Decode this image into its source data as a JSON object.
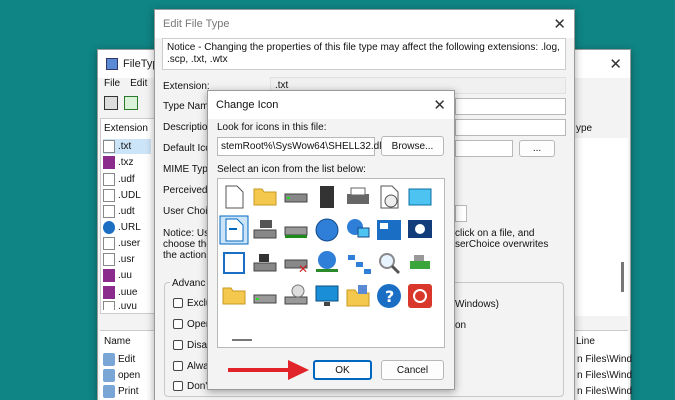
{
  "filetypes_window": {
    "title": "FileTyp",
    "menu": [
      "File",
      "Edit"
    ],
    "column_header": "Extension",
    "right_header": "ype",
    "extensions": [
      ".txt",
      ".txz",
      ".udf",
      ".UDL",
      ".udt",
      ".URL",
      ".user",
      ".usr",
      ".uu",
      ".uue",
      ".uvu"
    ],
    "bottom_header": "Name",
    "bottom_right_header": "Line",
    "actions": [
      "Edit",
      "open",
      "Print"
    ],
    "right_paths": [
      "n Files\\Wind",
      "n Files\\Wind",
      "n Files\\Wind"
    ]
  },
  "edit_window": {
    "title": "Edit File Type",
    "notice": "Notice - Changing the properties of this file type may affect the following extensions: .log, .scp, .txt, .wtx",
    "labels": [
      "Extension:",
      "Type Name",
      "Description",
      "Default Ico",
      "MIME Type",
      "Perceived T",
      "User Choic"
    ],
    "extension_value": ".txt",
    "browse_dots": "...",
    "notice2_lines": [
      "Notice: Use",
      "choose the",
      "the actions"
    ],
    "notice2_right_lines": [
      "click on a file, and",
      "serChoice overwrites"
    ],
    "advanced_label": "Advanc",
    "checkboxes": [
      "Exclu",
      "Open",
      "Disab",
      "Alwa",
      "Don't"
    ],
    "right_checkbox_texts": [
      "Windows)",
      "on"
    ]
  },
  "change_icon": {
    "title": "Change Icon",
    "look_label": "Look for icons in this file:",
    "path_value": "stemRoot%\\SysWow64\\SHELL32.dll",
    "browse_label": "Browse...",
    "select_label": "Select an icon from the list below:",
    "ok_label": "OK",
    "cancel_label": "Cancel",
    "icon_names": [
      "blank-document-icon",
      "folder-icon",
      "drive-icon",
      "chip-icon",
      "printer-icon",
      "clock-document-icon",
      "screen-icon",
      "text-document-icon",
      "drive-computer-icon",
      "drive-green-icon",
      "globe-icon",
      "network-computer-icon",
      "settings-panel-icon",
      "moon-monitor-icon",
      "window-icon",
      "floppy-drive-icon",
      "drive-error-icon",
      "network-globe-icon",
      "network-tree-icon",
      "magnifier-icon",
      "usb-icon",
      "folder-yellow-icon",
      "drive-small-icon",
      "drive-cd-icon",
      "monitor-icon",
      "grid-folder-icon",
      "help-icon",
      "power-icon"
    ]
  },
  "colors": {
    "background": "#0f8585",
    "accent": "#0067c0",
    "arrow": "#e0242a"
  }
}
